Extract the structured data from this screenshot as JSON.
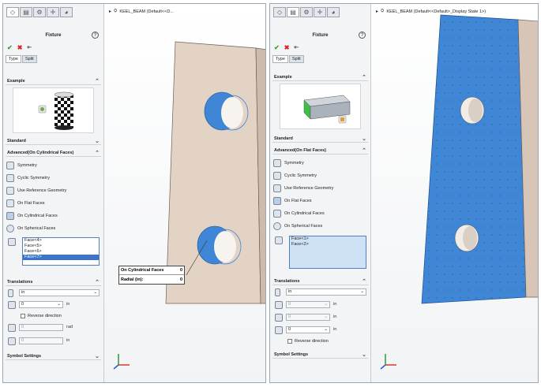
{
  "left": {
    "pm": {
      "title": "Fixture",
      "help": "?",
      "tabs": [
        "Type",
        "Split"
      ],
      "example": "Example",
      "standard": "Standard",
      "advanced": "Advanced(On Cylindrical Faces)",
      "options": [
        "Symmetry",
        "Cyclic Symmetry",
        "Use Reference Geometry",
        "On Flat Faces",
        "On Cylindrical Faces",
        "On Spherical Faces"
      ],
      "faces": [
        "Face<4>",
        "Face<5>",
        "Face<6>",
        "Face<7>"
      ],
      "translations": "Translations",
      "unit_select": "in",
      "value1": "0",
      "unit_in": "in",
      "reverse": "Reverse direction",
      "value2": "0",
      "unit_rad": "rad",
      "value3": "0",
      "symbol": "Symbol Settings"
    },
    "viewport": {
      "crumb": "KEEL_BEAM  (Default<<D...",
      "popup": {
        "label1": "On Cylindrical Faces",
        "value1": "0",
        "label2": "Radial (in):",
        "value2": "0"
      }
    }
  },
  "right": {
    "pm": {
      "title": "Fixture",
      "help": "?",
      "tabs": [
        "Type",
        "Split"
      ],
      "example": "Example",
      "standard": "Standard",
      "advanced": "Advanced(On Flat Faces)",
      "options": [
        "Symmetry",
        "Cyclic Symmetry",
        "Use Reference Geometry",
        "On Flat Faces",
        "On Cylindrical Faces",
        "On Spherical Faces"
      ],
      "faces": [
        "Face<1>",
        "Face<2>"
      ],
      "translations": "Translations",
      "unit_select": "in",
      "value1": "0",
      "value2": "0",
      "value3": "0",
      "unit_in": "in",
      "reverse": "Reverse direction",
      "symbol": "Symbol Settings"
    },
    "viewport": {
      "crumb": "KEEL_BEAM  (Default<<Default>_Display State 1>)"
    }
  },
  "colors": {
    "selection_blue": "#3c74c8",
    "face_blue": "#3f86d6",
    "part_tan": "#e2d2c4"
  }
}
